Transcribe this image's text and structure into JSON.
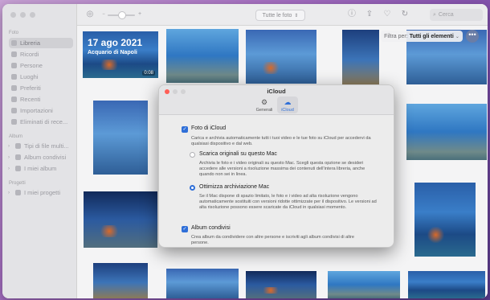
{
  "sidebar": {
    "sections": {
      "photos": "Foto",
      "albums": "Album",
      "projects": "Progetti"
    },
    "items": [
      {
        "label": "Libreria",
        "icon": "photo-library-icon"
      },
      {
        "label": "Ricordi",
        "icon": "memories-icon"
      },
      {
        "label": "Persone",
        "icon": "people-icon"
      },
      {
        "label": "Luoghi",
        "icon": "places-icon"
      },
      {
        "label": "Preferiti",
        "icon": "heart-icon"
      },
      {
        "label": "Recenti",
        "icon": "clock-icon"
      },
      {
        "label": "Importazioni",
        "icon": "import-icon"
      },
      {
        "label": "Eliminati di rece...",
        "icon": "trash-icon"
      }
    ],
    "albums": [
      {
        "label": "Tipi di file multi..."
      },
      {
        "label": "Album condivisi"
      },
      {
        "label": "I miei album"
      }
    ],
    "projects": [
      {
        "label": "I miei progetti"
      }
    ]
  },
  "toolbar": {
    "view_select": "Tutte le foto",
    "search_placeholder": "Cerca"
  },
  "grid": {
    "first_photo": {
      "date": "17 ago 2021",
      "place": "Acquario di Napoli",
      "duration": "0:08"
    },
    "filter_prefix": "Filtra per:",
    "filter_value": "Tutti gli elementi",
    "more_label": "•••"
  },
  "dialog": {
    "title": "iCloud",
    "tabs": [
      {
        "label": "Generali",
        "icon": "gear-icon"
      },
      {
        "label": "iCloud",
        "icon": "cloud-icon"
      }
    ],
    "icloud_photos": {
      "label": "Foto di iCloud",
      "checked": true,
      "description": "Carica e archivia automaticamente tutti i tuoi video e le tue foto su iCloud per accedervi da qualsiasi dispositivo e dal web."
    },
    "download_originals": {
      "label": "Scarica originali su questo Mac",
      "description": "Archivia le foto e i video originali su questo Mac. Scegli questa opzione se desideri accedere alle versioni a risoluzione massima dei contenuti dell'intera libreria, anche quando non sei in linea."
    },
    "optimize": {
      "label": "Ottimizza archiviazione Mac",
      "selected": true,
      "description": "Se il Mac dispone di spazio limitato, le foto e i video ad alta risoluzione vengono automaticamente sostituiti con versioni ridotte ottimizzate per il dispositivo. Le versioni ad alta risoluzione possono essere scaricate da iCloud in qualsiasi momento."
    },
    "shared_albums": {
      "label": "Album condivisi",
      "checked": true,
      "description": "Crea album da condividere con altre persone e iscriviti agli album condivisi di altre persone."
    }
  },
  "colors": {
    "accent": "#2f6fd8",
    "close": "#ff5f57",
    "minimize": "#d8d8da",
    "zoom": "#d8d8da"
  }
}
